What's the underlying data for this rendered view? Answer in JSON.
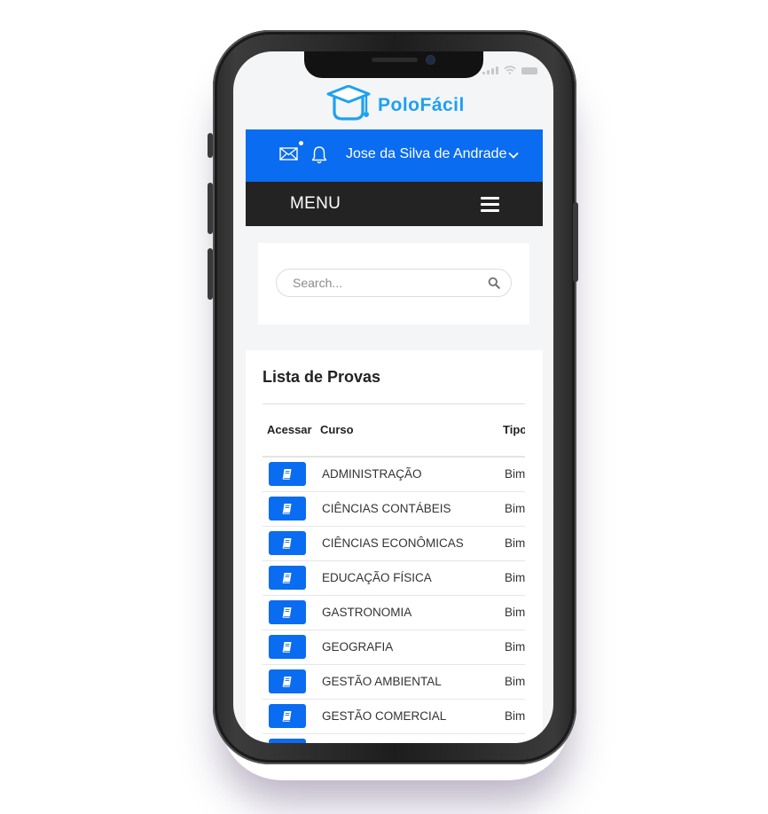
{
  "brand": {
    "name": "PoloFácil",
    "color": "#1da1f2",
    "icon": "graduation-cap-icon"
  },
  "header": {
    "mail_icon": "mail-icon",
    "bell_icon": "bell-icon",
    "user_name": "Jose da Silva de Andrade",
    "dropdown_icon": "chevron-down-icon",
    "bar_color": "#0a6cf0"
  },
  "menu": {
    "label": "MENU",
    "toggle_icon": "hamburger-icon",
    "bar_color": "#232323"
  },
  "search": {
    "placeholder": "Search...",
    "value": "",
    "icon": "search-icon"
  },
  "list": {
    "title": "Lista de Provas",
    "columns": [
      "Acessar",
      "Curso",
      "Tipo"
    ],
    "button_icon": "book-icon",
    "button_color": "#0a6cf0",
    "rows": [
      {
        "curso": "ADMINISTRAÇÃO",
        "tipo": "Bim"
      },
      {
        "curso": "CIÊNCIAS CONTÁBEIS",
        "tipo": "Bim"
      },
      {
        "curso": "CIÊNCIAS ECONÔMICAS",
        "tipo": "Bim"
      },
      {
        "curso": "EDUCAÇÃO FÍSICA",
        "tipo": "Bim"
      },
      {
        "curso": "GASTRONOMIA",
        "tipo": "Bim"
      },
      {
        "curso": "GEOGRAFIA",
        "tipo": "Bim"
      },
      {
        "curso": "GESTÃO AMBIENTAL",
        "tipo": "Bim"
      },
      {
        "curso": "GESTÃO COMERCIAL",
        "tipo": "Bim"
      },
      {
        "curso": "",
        "tipo": ""
      }
    ]
  }
}
